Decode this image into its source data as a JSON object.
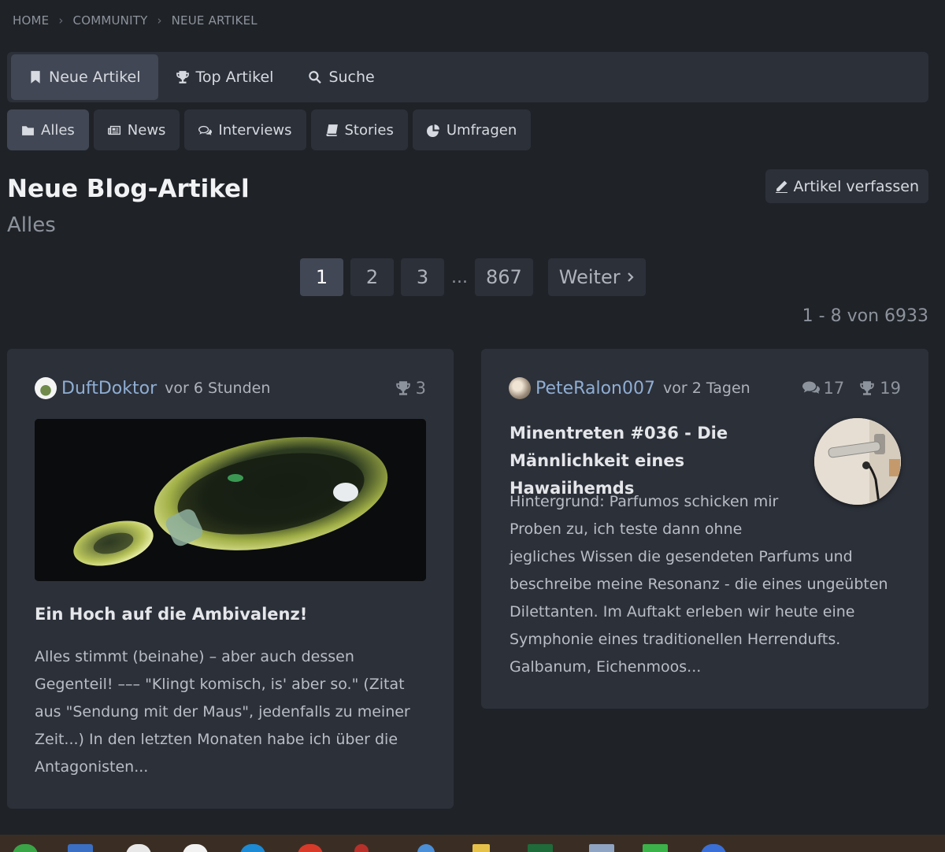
{
  "breadcrumb": [
    "HOME",
    "COMMUNITY",
    "NEUE ARTIKEL"
  ],
  "main_nav": [
    {
      "label": "Neue Artikel",
      "icon": "bookmark-icon",
      "active": true
    },
    {
      "label": "Top Artikel",
      "icon": "trophy-icon",
      "active": false
    },
    {
      "label": "Suche",
      "icon": "search-icon",
      "active": false
    }
  ],
  "sub_nav": [
    {
      "label": "Alles",
      "icon": "folder-icon",
      "active": true
    },
    {
      "label": "News",
      "icon": "newspaper-icon",
      "active": false
    },
    {
      "label": "Interviews",
      "icon": "chat-icon",
      "active": false
    },
    {
      "label": "Stories",
      "icon": "book-icon",
      "active": false
    },
    {
      "label": "Umfragen",
      "icon": "pie-chart-icon",
      "active": false
    }
  ],
  "header": {
    "title": "Neue Blog-Artikel",
    "subtitle": "Alles",
    "compose_label": "Artikel verfassen"
  },
  "pagination": {
    "pages": [
      "1",
      "2",
      "3"
    ],
    "ellipsis": "...",
    "last": "867",
    "current": "1",
    "next_label": "Weiter"
  },
  "result_count": "1 - 8 von 6933",
  "articles": [
    {
      "author": "DuftDoktor",
      "time": "vor 6 Stunden",
      "trophies": "3",
      "title": "Ein Hoch auf die Ambivalenz!",
      "excerpt": "Alles stimmt (beinahe) – aber auch dessen Gegenteil! ––– \"Klingt komisch, is' aber so.\" (Zitat aus \"Sendung mit der Maus\", jedenfalls zu meiner Zeit...) In den letzten Monaten habe ich über die Antagonisten..."
    },
    {
      "author": "PeteRalon007",
      "time": "vor 2 Tagen",
      "comments": "17",
      "trophies": "19",
      "title": "Minentreten #036 - Die Männlichkeit eines Hawaiihemds",
      "excerpt_lines": [
        "Hintergrund: Parfumos schicken mir",
        "Proben zu, ich teste dann ohne",
        "jegliches Wissen die gesendeten Parfums und",
        "beschreibe meine Resonanz - die eines ungeübten",
        "Dilettanten. Im Auftakt erleben wir heute eine",
        "Symphonie eines traditionellen Herrendufts.",
        "Galbanum, Eichenmoos..."
      ]
    }
  ],
  "colors": {
    "background": "#1f2227",
    "panel": "#2c3039",
    "active_tab": "#414754",
    "author_link": "#8faed3",
    "muted_text": "#8d939c"
  }
}
